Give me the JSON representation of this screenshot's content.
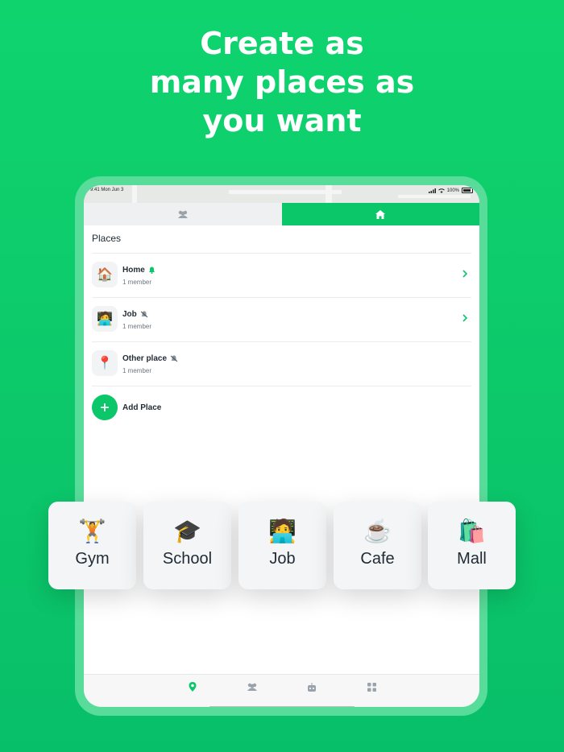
{
  "headline": [
    "Create as",
    "many places as",
    "you want"
  ],
  "status": {
    "time_date": "9:41 Mon Jun 3",
    "battery": "100%"
  },
  "tabs": [
    {
      "name": "people",
      "icon": "people-icon"
    },
    {
      "name": "home",
      "icon": "home-icon"
    }
  ],
  "section_title": "Places",
  "places": [
    {
      "emoji": "🏠",
      "name": "Home",
      "status_icon": "bell-icon",
      "members": "1 member",
      "chevron": true
    },
    {
      "emoji": "🧑‍💻",
      "name": "Job",
      "status_icon": "bell-muted-icon",
      "members": "1 member",
      "chevron": true
    },
    {
      "emoji": "📍",
      "name": "Other place",
      "status_icon": "bell-muted-icon",
      "members": "1 member",
      "chevron": false
    }
  ],
  "add_place_label": "Add Place",
  "bottom_nav": [
    {
      "name": "places",
      "icon": "location-pin-icon"
    },
    {
      "name": "people",
      "icon": "people-icon"
    },
    {
      "name": "assistant",
      "icon": "robot-icon"
    },
    {
      "name": "more",
      "icon": "grid-icon"
    }
  ],
  "cards": [
    {
      "emoji": "🏋️",
      "label": "Gym"
    },
    {
      "emoji": "🎓",
      "label": "School"
    },
    {
      "emoji": "🧑‍💻",
      "label": "Job"
    },
    {
      "emoji": "☕",
      "label": "Cafe"
    },
    {
      "emoji": "🛍️",
      "label": "Mall"
    }
  ],
  "colors": {
    "accent": "#0cc76a",
    "background": "#0fd46e"
  }
}
